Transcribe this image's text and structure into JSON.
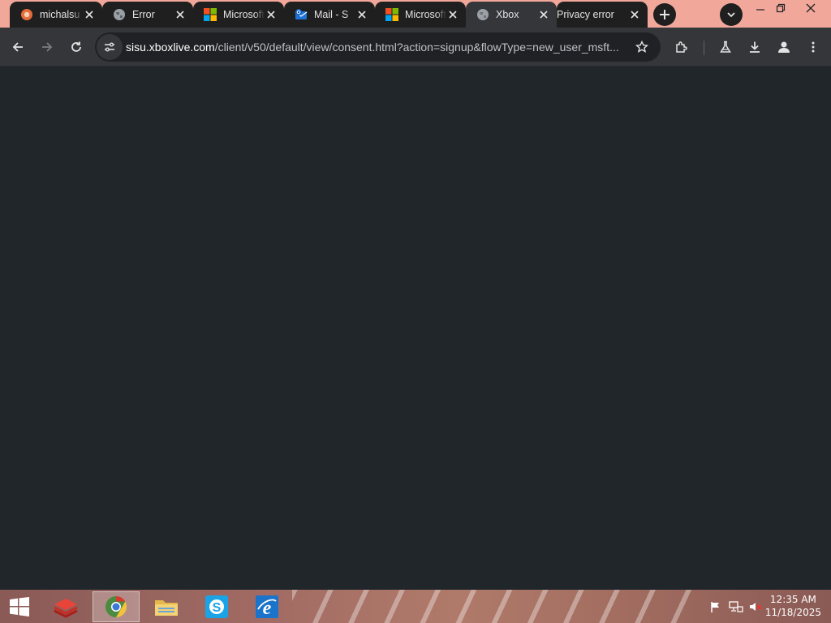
{
  "tabs": [
    {
      "title": "michalsu",
      "favicon": "firefox-sync-icon",
      "active": false
    },
    {
      "title": "Error",
      "favicon": "globe-icon",
      "active": false
    },
    {
      "title": "Microsoft",
      "favicon": "microsoft-logo-icon",
      "active": false
    },
    {
      "title": "Mail - S",
      "favicon": "outlook-icon",
      "active": false
    },
    {
      "title": "Microsoft",
      "favicon": "microsoft-logo-icon",
      "active": false
    },
    {
      "title": "Xbox",
      "favicon": "globe-icon",
      "active": true
    },
    {
      "title": "Privacy error",
      "favicon": "none",
      "active": false
    }
  ],
  "address_bar": {
    "host": "sisu.xboxlive.com",
    "path": "/client/v50/default/view/consent.html?action=signup&flowType=new_user_msft..."
  },
  "toolbar_icons": [
    "back-arrow-icon",
    "forward-arrow-icon",
    "reload-icon",
    "site-info-icon",
    "bookmark-star-icon",
    "extensions-puzzle-icon",
    "labs-flask-icon",
    "download-icon",
    "profile-icon",
    "more-menu-icon"
  ],
  "taskbar": {
    "apps": [
      "app-stack-icon",
      "chrome-icon",
      "file-explorer-icon",
      "skype-icon",
      "internet-explorer-icon"
    ],
    "clock_time": "12:35 AM",
    "clock_date": "11/18/2025",
    "tray_icons": [
      "action-center-flag-icon",
      "network-icon",
      "speaker-muted-icon"
    ]
  },
  "colors": {
    "tabstrip": "#f1a89a",
    "tab_bg": "#1f1f1f",
    "active_tab_bg": "#35363a",
    "page_bg": "#21262b"
  }
}
